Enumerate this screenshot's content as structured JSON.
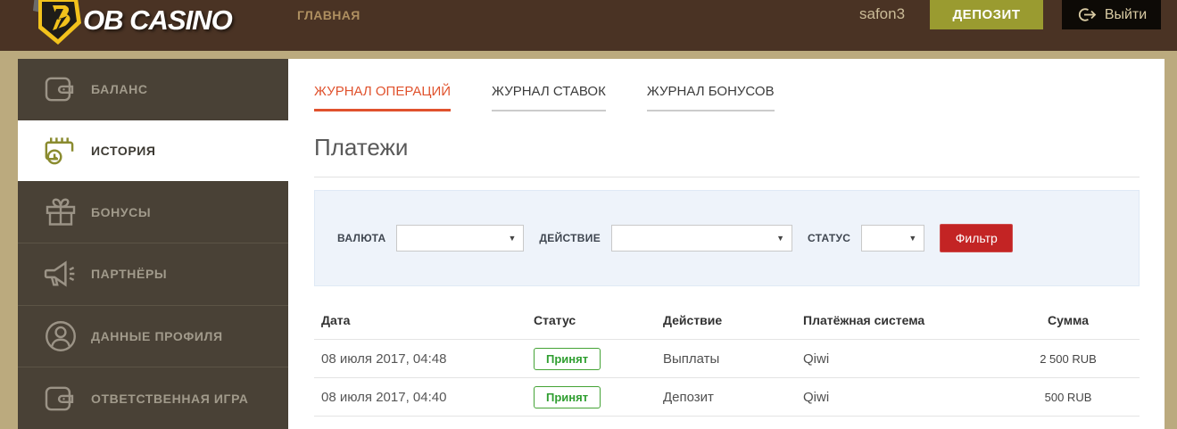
{
  "header": {
    "logo_text": "OB CASINO",
    "nav_main": "ГЛАВНАЯ",
    "username": "safon3",
    "deposit_label": "ДЕПОЗИТ",
    "logout_label": "Выйти"
  },
  "sidebar": {
    "items": [
      {
        "label": "БАЛАНС",
        "icon": "wallet-icon",
        "active": false
      },
      {
        "label": "ИСТОРИЯ",
        "icon": "calendar-clock-icon",
        "active": true
      },
      {
        "label": "БОНУСЫ",
        "icon": "gift-icon",
        "active": false
      },
      {
        "label": "ПАРТНЁРЫ",
        "icon": "megaphone-icon",
        "active": false
      },
      {
        "label": "ДАННЫЕ ПРОФИЛЯ",
        "icon": "user-icon",
        "active": false
      },
      {
        "label": "ОТВЕТСТВЕННАЯ ИГРА",
        "icon": "wallet-icon",
        "active": false
      }
    ]
  },
  "main": {
    "tabs": [
      {
        "label": "ЖУРНАЛ ОПЕРАЦИЙ",
        "active": true
      },
      {
        "label": "ЖУРНАЛ СТАВОК",
        "active": false
      },
      {
        "label": "ЖУРНАЛ БОНУСОВ",
        "active": false
      }
    ],
    "title": "Платежи",
    "filters": {
      "currency_label": "ВАЛЮТА",
      "currency_value": "",
      "action_label": "ДЕЙСТВИЕ",
      "action_value": "",
      "status_label": "СТАТУС",
      "status_value": "",
      "filter_button_label": "Фильтр"
    },
    "table": {
      "headers": [
        "Дата",
        "Статус",
        "Действие",
        "Платёжная система",
        "Сумма"
      ],
      "rows": [
        {
          "date": "08 июля 2017, 04:48",
          "status": "Принят",
          "action": "Выплаты",
          "system": "Qiwi",
          "amount": "2 500 RUB"
        },
        {
          "date": "08 июля 2017, 04:40",
          "status": "Принят",
          "action": "Депозит",
          "system": "Qiwi",
          "amount": "500 RUB"
        }
      ]
    }
  },
  "colors": {
    "header_bg": "#4a3324",
    "page_bg": "#bbaa7e",
    "sidebar_bg": "#494136",
    "deposit_olive": "#9a9b30",
    "logout_black": "#0d0a06",
    "tab_active_red": "#e0522d",
    "filter_panel_blue": "#eef3fa",
    "filter_button_red": "#c32424",
    "status_green": "#2f9e30",
    "logo_yellow": "#f2c21c"
  }
}
